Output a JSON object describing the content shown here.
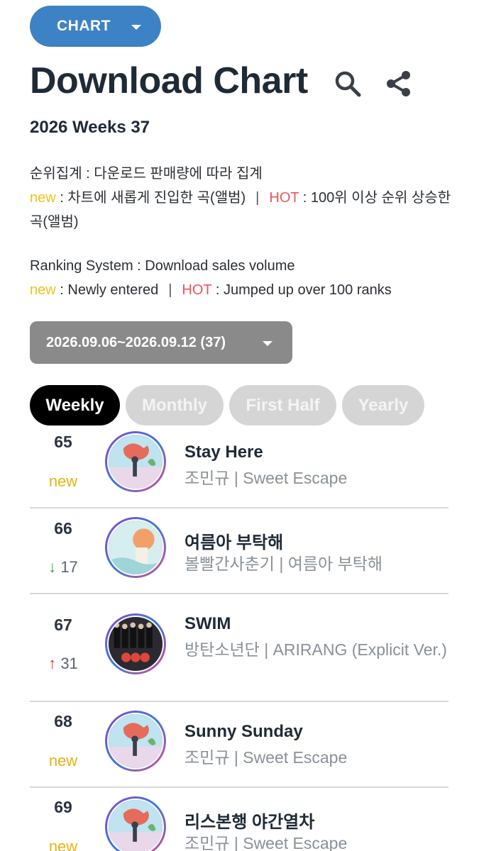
{
  "header": {
    "chart_menu_label": "CHART",
    "title": "Download Chart",
    "week_label": "2026 Weeks 37"
  },
  "description": {
    "ko_ranking": "순위집계 : 다운로드 판매량에 따라 집계",
    "ko_new_tag": "new",
    "ko_new_text": " : 차트에 새롭게 진입한 곡(앨범)",
    "ko_sep": "|",
    "ko_hot_tag": "HOT",
    "ko_hot_text": " : 100위 이상 순위 상승한 곡(앨범)",
    "en_ranking": "Ranking System : Download sales volume",
    "en_new_tag": "new",
    "en_new_text": " : Newly entered",
    "en_sep": "|",
    "en_hot_tag": "HOT",
    "en_hot_text": " : Jumped up over 100 ranks"
  },
  "date_selector": {
    "label": "2026.09.06~2026.09.12 (37)"
  },
  "tabs": [
    {
      "label": "Weekly",
      "active": true
    },
    {
      "label": "Monthly",
      "active": false
    },
    {
      "label": "First Half",
      "active": false
    },
    {
      "label": "Yearly",
      "active": false
    }
  ],
  "entries": [
    {
      "rank": "65",
      "change_type": "new",
      "change_label": "new",
      "title": "Stay Here",
      "subtitle": "조민규 | Sweet Escape"
    },
    {
      "rank": "66",
      "change_type": "down",
      "change_arrow": "↓",
      "change_value": "17",
      "title": "여름아 부탁해",
      "subtitle": "볼빨간사춘기 | 여름아 부탁해"
    },
    {
      "rank": "67",
      "change_type": "up",
      "change_arrow": "↑",
      "change_value": "31",
      "title": "SWIM",
      "subtitle": "방탄소년단 | ARIRANG (Explicit Ver.)"
    },
    {
      "rank": "68",
      "change_type": "new",
      "change_label": "new",
      "title": "Sunny Sunday",
      "subtitle": "조민규 | Sweet Escape"
    },
    {
      "rank": "69",
      "change_type": "new",
      "change_label": "new",
      "title": "리스본행 야간열차",
      "subtitle": "조민규 | Sweet Escape"
    }
  ],
  "icons": {
    "search": "search-icon",
    "share": "share-icon",
    "dropdown": "chevron-down-icon"
  },
  "colors": {
    "chart_button": "#3d82c4",
    "new_tag": "#f2c21b",
    "hot_tag": "#e8565a",
    "arrow_up": "#e03030",
    "arrow_down": "#2e9e3e",
    "active_tab": "#000000",
    "inactive_tab": "#d5d5d5"
  }
}
